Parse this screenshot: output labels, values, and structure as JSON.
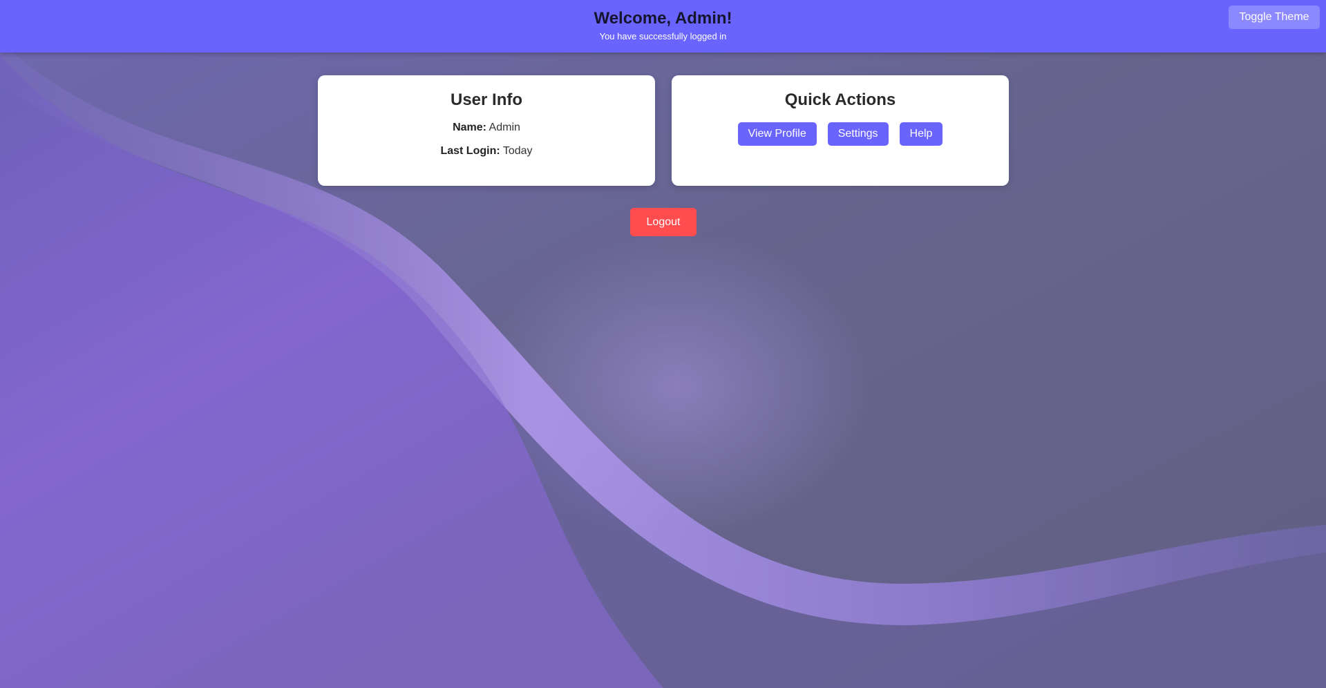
{
  "header": {
    "title": "Welcome, Admin!",
    "subtitle": "You have successfully logged in",
    "toggle_theme_label": "Toggle Theme"
  },
  "user_info": {
    "title": "User Info",
    "name_label": "Name:",
    "name_value": "Admin",
    "last_login_label": "Last Login:",
    "last_login_value": "Today"
  },
  "quick_actions": {
    "title": "Quick Actions",
    "buttons": [
      {
        "label": "View Profile"
      },
      {
        "label": "Settings"
      },
      {
        "label": "Help"
      }
    ]
  },
  "logout_label": "Logout",
  "colors": {
    "header_bg": "#6a64ff",
    "primary_button": "#6a64ff",
    "logout_button": "#ff4d4f",
    "background": "#656386",
    "wave_purple": "#8a66d6"
  }
}
